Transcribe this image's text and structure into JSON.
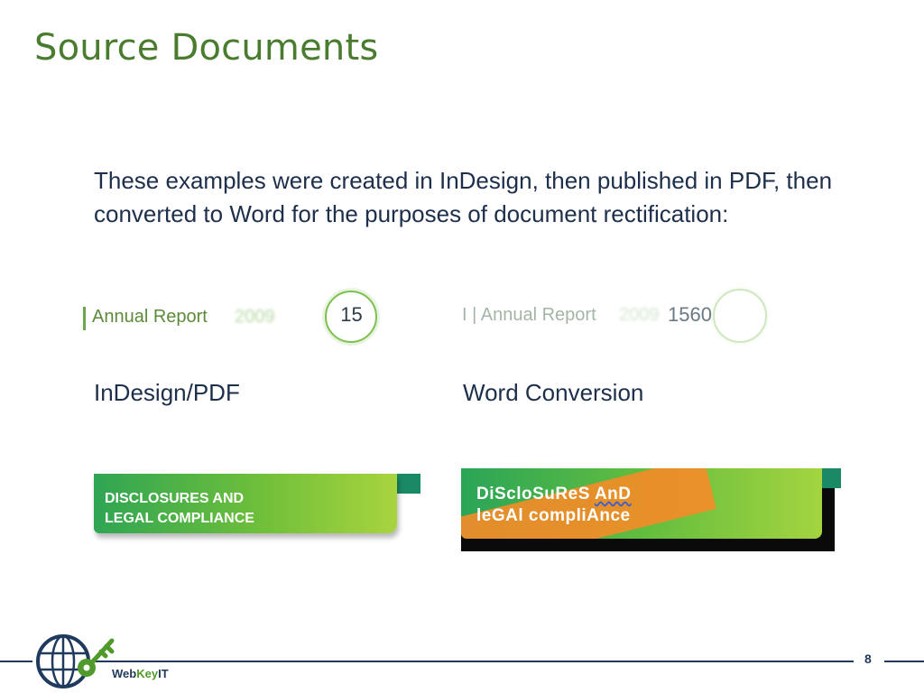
{
  "slide": {
    "title": "Source Documents",
    "body": "These examples were created in InDesign, then published in PDF, then converted to Word for the purposes of document rectification:",
    "captions": {
      "left": "InDesign/PDF",
      "right": "Word Conversion"
    },
    "header_left": {
      "label": "Annual Report",
      "year": "2009",
      "number": "15"
    },
    "header_right": {
      "label": "I | Annual Report",
      "year": "2009",
      "number": "1560"
    },
    "banner_left": {
      "line1": "DISCLOSURES AND",
      "line2": "LEGAL COMPLIANCE"
    },
    "banner_right": {
      "line1_part1": "DiScloSuReS ",
      "line1_part2": "AnD",
      "line2": "leGAl compliAnce"
    }
  },
  "footer": {
    "brand_web": "Web",
    "brand_key": "Key",
    "brand_it": "IT",
    "page_number": "8"
  },
  "colors": {
    "title": "#4a7c2f",
    "text": "#1d2f4a",
    "banner_green": "#6fbf3a",
    "banner_teal": "#1a8a66",
    "banner_orange": "#f28c28",
    "navy": "#1f3a5c"
  }
}
